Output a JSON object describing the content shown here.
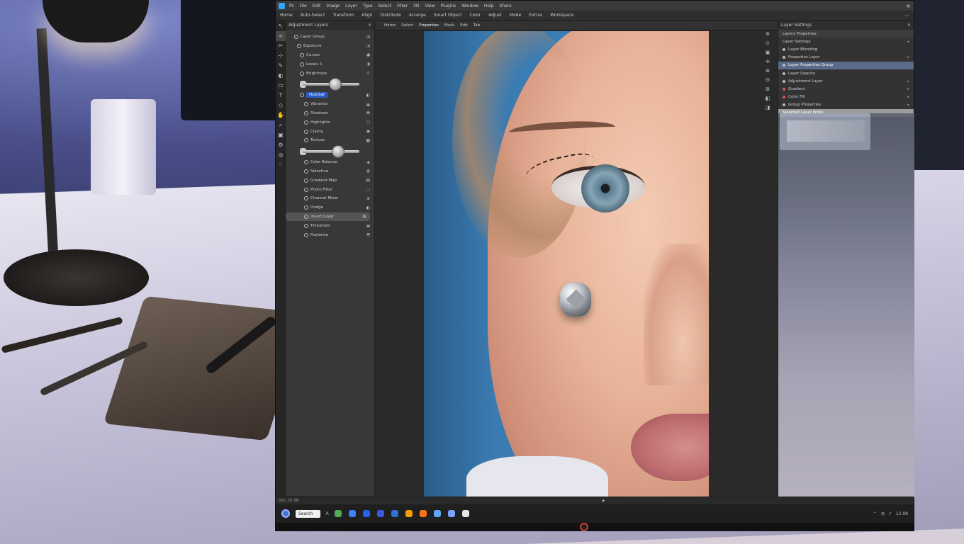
{
  "titlebar": {
    "items": [
      "Ps",
      "File",
      "Edit",
      "Image",
      "Layer",
      "Type",
      "Select",
      "Filter",
      "3D",
      "View",
      "Plugins",
      "Window",
      "Help",
      "Share"
    ],
    "close_label": "×"
  },
  "menubar": {
    "items": [
      "Home",
      "Auto-Select",
      "Transform",
      "Align",
      "Distribute",
      "Arrange",
      "Smart Object",
      "Color",
      "Adjust",
      "Mode",
      "Extras",
      "Workspace"
    ],
    "right_icon": "⋯"
  },
  "toolbox": {
    "tools": [
      "↖",
      "⌗",
      "✂",
      "⊹",
      "✎",
      "◐",
      "▭",
      "T",
      "◇",
      "✋",
      "⌕",
      "▣",
      "⚙",
      "◎",
      "♢"
    ]
  },
  "left_panel": {
    "title": "Adjustment Layers",
    "close": "×",
    "rows": [
      {
        "label": "Layer Group",
        "icon": "⊞",
        "indent": 12
      },
      {
        "label": "Exposure",
        "icon": "◔",
        "indent": 16
      },
      {
        "label": "Curves",
        "icon": "◕",
        "indent": 20
      },
      {
        "label": "Levels 1",
        "icon": "◑",
        "indent": 20
      },
      {
        "label": "Brightness",
        "icon": "☼",
        "indent": 20
      },
      {
        "slider": true,
        "knob": 0.58
      },
      {
        "label": "Hue/Sat",
        "icon": "◐",
        "indent": 20,
        "selected": true
      },
      {
        "label": "Vibrance",
        "icon": "◒",
        "indent": 26
      },
      {
        "label": "Shadows",
        "icon": "◓",
        "indent": 26
      },
      {
        "label": "Highlights",
        "icon": "○",
        "indent": 26
      },
      {
        "label": "Clarity",
        "icon": "◉",
        "indent": 26
      },
      {
        "label": "Texture",
        "icon": "▦",
        "indent": 26
      },
      {
        "slider": true,
        "knob": 0.62
      },
      {
        "label": "Color Balance",
        "icon": "◈",
        "indent": 26
      },
      {
        "label": "Selective",
        "icon": "◍",
        "indent": 26
      },
      {
        "label": "Gradient Map",
        "icon": "▤",
        "indent": 26
      },
      {
        "label": "Photo Filter",
        "icon": "◌",
        "indent": 26
      },
      {
        "label": "Channel Mixer",
        "icon": "⊕",
        "indent": 26
      },
      {
        "label": "Dodge",
        "icon": "◐",
        "indent": 26
      },
      {
        "label": "Invert Layer",
        "icon": "◑",
        "indent": 26,
        "highlight": true
      },
      {
        "label": "Threshold",
        "icon": "◒",
        "indent": 26
      },
      {
        "label": "Posterize",
        "icon": "◓",
        "indent": 26
      }
    ]
  },
  "canvas": {
    "tabs": [
      "Home",
      "Select",
      "Properties",
      "Mask",
      "Edit",
      "Tab"
    ],
    "active_tab": 2,
    "mini_tools": [
      "⊕",
      "⊙",
      "▣",
      "✣",
      "⊞",
      "⊟",
      "⊠",
      "◧",
      "◨"
    ]
  },
  "right_panel": {
    "title": "Layer Settings",
    "close": "×",
    "section": "Layers Properties",
    "rows": [
      {
        "label": "Layer Settings",
        "dot": "none",
        "arrow": "▸"
      },
      {
        "label": "Layer Blending",
        "dot": "normal"
      },
      {
        "label": "Properties Layer",
        "dot": "normal",
        "arrow": "▸"
      },
      {
        "label": "Layer Properties Group",
        "dot": "normal",
        "selected": "blue"
      },
      {
        "label": "Layer Opacity",
        "dot": "normal"
      },
      {
        "label": "Adjustment Layer",
        "dot": "normal",
        "arrow": "▸"
      },
      {
        "label": "Gradient",
        "dot": "red",
        "arrow": "▸"
      },
      {
        "label": "Color Fill",
        "dot": "red",
        "arrow": "▸"
      },
      {
        "label": "Group Properties",
        "dot": "normal",
        "arrow": "▸"
      },
      {
        "label": "Selected Layer Props",
        "dot": "none",
        "selected": "gray",
        "arrow": "▸"
      }
    ]
  },
  "statusbar": {
    "left": "Doc: 25.3M",
    "mid": "◆"
  },
  "taskbar": {
    "search_label": "Search",
    "caret": "Λ",
    "icons": [
      {
        "name": "browser-icon",
        "color": "#4caf50"
      },
      {
        "name": "chrome-icon",
        "color": "#3b82f6"
      },
      {
        "name": "edge-icon",
        "color": "#2563eb"
      },
      {
        "name": "shield-icon",
        "color": "#3b5bdb"
      },
      {
        "name": "store-icon",
        "color": "#2f6fd8"
      },
      {
        "name": "vlc-icon",
        "color": "#f59e0b"
      },
      {
        "name": "files-icon",
        "color": "#f97316"
      },
      {
        "name": "mail-icon",
        "color": "#60a5fa"
      },
      {
        "name": "calendar-icon",
        "color": "#7aa0ff"
      },
      {
        "name": "photos-icon",
        "color": "#e5e7eb"
      }
    ],
    "tray": [
      "⌃",
      "◔",
      "♪",
      "12:08"
    ]
  }
}
